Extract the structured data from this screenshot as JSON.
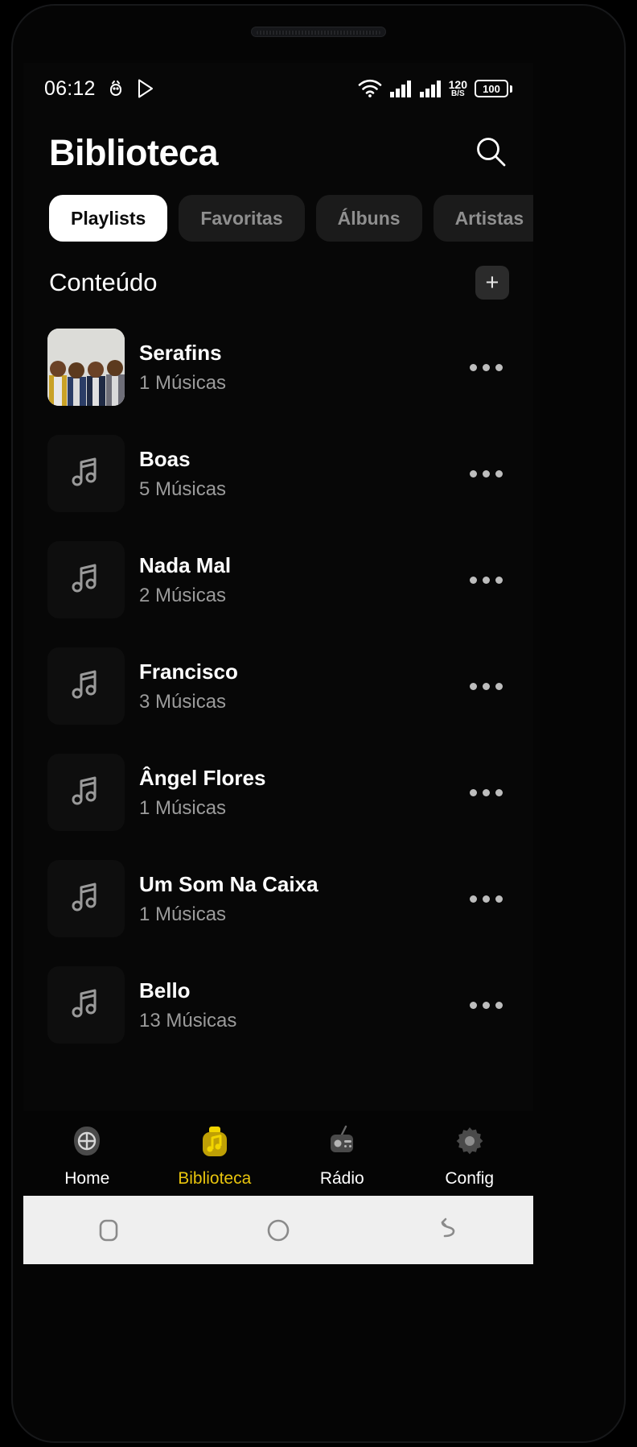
{
  "status_bar": {
    "time": "06:12",
    "icons": [
      "usb-debug-icon",
      "play-store-icon",
      "wifi-icon",
      "signal-1-icon",
      "signal-2-icon"
    ],
    "net_speed_value": "120",
    "net_speed_unit": "B/S",
    "battery_level": "100"
  },
  "header": {
    "title": "Biblioteca",
    "search_icon": "search-icon"
  },
  "tabs": [
    {
      "label": "Playlists",
      "active": true
    },
    {
      "label": "Favoritas",
      "active": false
    },
    {
      "label": "Álbuns",
      "active": false
    },
    {
      "label": "Artistas",
      "active": false
    }
  ],
  "section": {
    "title": "Conteúdo",
    "add_label": "+"
  },
  "playlists": [
    {
      "title": "Serafins",
      "subtitle": "1  Músicas",
      "thumb": "photo"
    },
    {
      "title": "Boas",
      "subtitle": "5  Músicas",
      "thumb": "music-note-icon"
    },
    {
      "title": "Nada Mal",
      "subtitle": "2  Músicas",
      "thumb": "music-note-icon"
    },
    {
      "title": "Francisco",
      "subtitle": "3  Músicas",
      "thumb": "music-note-icon"
    },
    {
      "title": "Ângel Flores",
      "subtitle": "1  Músicas",
      "thumb": "music-note-icon"
    },
    {
      "title": "Um Som Na Caixa",
      "subtitle": "1  Músicas",
      "thumb": "music-note-icon"
    },
    {
      "title": "Bello",
      "subtitle": "13  Músicas",
      "thumb": "music-note-icon"
    }
  ],
  "bottom_nav": [
    {
      "label": "Home",
      "icon": "home-icon",
      "active": false
    },
    {
      "label": "Biblioteca",
      "icon": "library-icon",
      "active": true
    },
    {
      "label": "Rádio",
      "icon": "radio-icon",
      "active": false
    },
    {
      "label": "Config",
      "icon": "gear-icon",
      "active": false
    }
  ],
  "system_nav": [
    {
      "label": "recents",
      "icon": "recents-icon"
    },
    {
      "label": "home",
      "icon": "home-circle-icon"
    },
    {
      "label": "back",
      "icon": "back-arrow-icon"
    }
  ],
  "colors": {
    "accent": "#e8c40d",
    "background": "#070707",
    "tab_active_bg": "#ffffff",
    "subtitle": "#9b9b9b"
  }
}
